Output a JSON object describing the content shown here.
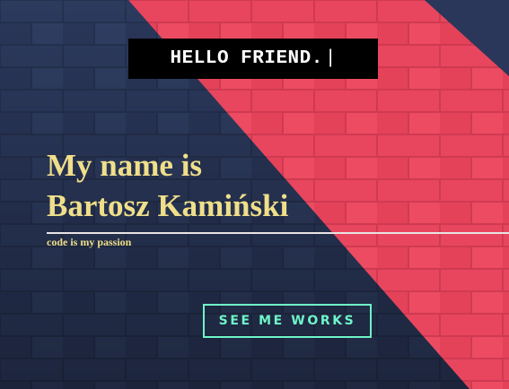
{
  "hero": {
    "greeting": "HELLO FRIEND.",
    "cursor": "|",
    "name_line_1": "My name is",
    "name_line_2": "Bartosz Kamiński",
    "tagline": "code is my passion",
    "cta_label": "SEE ME WORKS"
  },
  "colors": {
    "dark_wall": "#1f2a44",
    "pink_stripe": "#e8445c",
    "name_text": "#f0df8a",
    "cta_accent": "#6ff5c8",
    "greeting_bg": "#000000",
    "greeting_text": "#ffffff"
  },
  "icons": {
    "background": "brick-wall-background"
  }
}
